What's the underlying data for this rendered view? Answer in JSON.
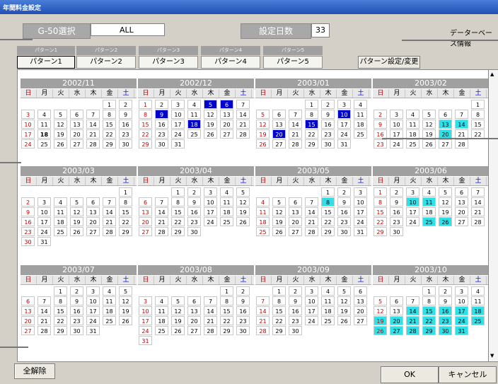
{
  "window": {
    "title": "年間料金設定"
  },
  "top": {
    "g50_label": "G-50選択",
    "g50_value": "ALL",
    "days_label": "設定日数",
    "days_value": "33",
    "db_info": "データーベース情報"
  },
  "patterns": {
    "headers": [
      "パターン1",
      "パターン2",
      "パターン3",
      "パターン4",
      "パターン5"
    ],
    "buttons": [
      "パターン1",
      "パターン2",
      "パターン3",
      "パターン4",
      "パターン5"
    ],
    "change_button": "パターン設定/変更"
  },
  "weekdays": [
    "日",
    "月",
    "火",
    "水",
    "木",
    "金",
    "土"
  ],
  "months": [
    {
      "title": "2002/11",
      "start": 5,
      "days": 30
    },
    {
      "title": "2002/12",
      "start": 0,
      "days": 31
    },
    {
      "title": "2003/01",
      "start": 3,
      "days": 31
    },
    {
      "title": "2003/02",
      "start": 6,
      "days": 28
    },
    {
      "title": "2003/03",
      "start": 6,
      "days": 31
    },
    {
      "title": "2003/04",
      "start": 2,
      "days": 30
    },
    {
      "title": "2003/05",
      "start": 4,
      "days": 31
    },
    {
      "title": "2003/06",
      "start": 0,
      "days": 30
    },
    {
      "title": "2003/07",
      "start": 2,
      "days": 31
    },
    {
      "title": "2003/08",
      "start": 5,
      "days": 31
    },
    {
      "title": "2003/09",
      "start": 1,
      "days": 30
    },
    {
      "title": "2003/10",
      "start": 3,
      "days": 31
    }
  ],
  "footer": {
    "clear_all": "全解除",
    "ok": "OK",
    "cancel": "キャンセル"
  }
}
